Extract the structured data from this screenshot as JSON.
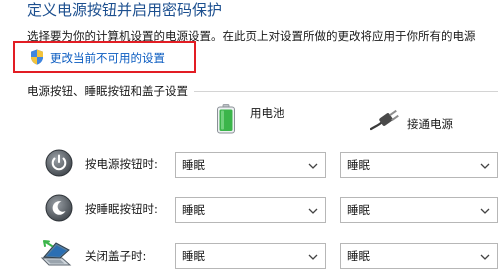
{
  "header": {
    "title": "定义电源按钮并启用密码保护",
    "description": "选择要为你的计算机设置的电源设置。在此页上对设置所做的更改将应用于你所有的电源"
  },
  "change_settings_link": {
    "label": "更改当前不可用的设置",
    "icon": "uac-shield-icon"
  },
  "section": {
    "title": "电源按钮、睡眠按钮和盖子设置"
  },
  "columns": {
    "battery": {
      "label": "用电池",
      "icon": "battery-icon"
    },
    "plugged_in": {
      "label": "接通电源",
      "icon": "power-plug-icon"
    }
  },
  "rows": [
    {
      "label": "按电源按钮时:",
      "icon": "power-button-icon",
      "battery_value": "睡眠",
      "plugged_value": "睡眠"
    },
    {
      "label": "按睡眠按钮时:",
      "icon": "sleep-button-icon",
      "battery_value": "睡眠",
      "plugged_value": "睡眠"
    },
    {
      "label": "关闭盖子时:",
      "icon": "laptop-lid-icon",
      "battery_value": "睡眠",
      "plugged_value": "睡眠"
    }
  ],
  "colors": {
    "title": "#1c4f8f",
    "link": "#0b5cc1",
    "highlight": "#e21d24",
    "battery_fill": "#3bb54a"
  }
}
